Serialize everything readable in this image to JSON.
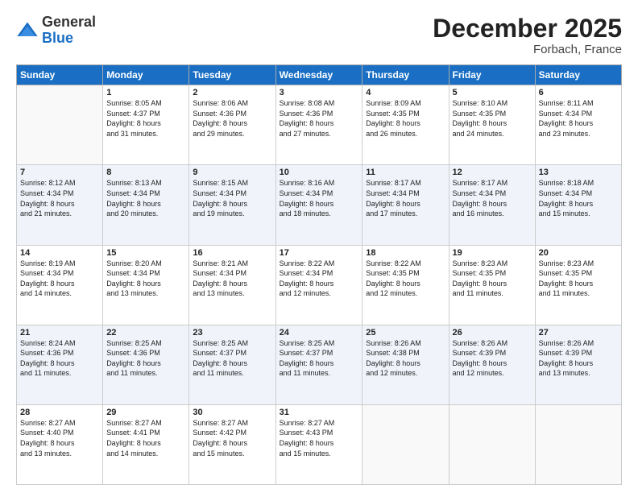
{
  "logo": {
    "general": "General",
    "blue": "Blue"
  },
  "title": "December 2025",
  "subtitle": "Forbach, France",
  "days_header": [
    "Sunday",
    "Monday",
    "Tuesday",
    "Wednesday",
    "Thursday",
    "Friday",
    "Saturday"
  ],
  "weeks": [
    [
      {
        "day": "",
        "info": ""
      },
      {
        "day": "1",
        "info": "Sunrise: 8:05 AM\nSunset: 4:37 PM\nDaylight: 8 hours\nand 31 minutes."
      },
      {
        "day": "2",
        "info": "Sunrise: 8:06 AM\nSunset: 4:36 PM\nDaylight: 8 hours\nand 29 minutes."
      },
      {
        "day": "3",
        "info": "Sunrise: 8:08 AM\nSunset: 4:36 PM\nDaylight: 8 hours\nand 27 minutes."
      },
      {
        "day": "4",
        "info": "Sunrise: 8:09 AM\nSunset: 4:35 PM\nDaylight: 8 hours\nand 26 minutes."
      },
      {
        "day": "5",
        "info": "Sunrise: 8:10 AM\nSunset: 4:35 PM\nDaylight: 8 hours\nand 24 minutes."
      },
      {
        "day": "6",
        "info": "Sunrise: 8:11 AM\nSunset: 4:34 PM\nDaylight: 8 hours\nand 23 minutes."
      }
    ],
    [
      {
        "day": "7",
        "info": "Sunrise: 8:12 AM\nSunset: 4:34 PM\nDaylight: 8 hours\nand 21 minutes."
      },
      {
        "day": "8",
        "info": "Sunrise: 8:13 AM\nSunset: 4:34 PM\nDaylight: 8 hours\nand 20 minutes."
      },
      {
        "day": "9",
        "info": "Sunrise: 8:15 AM\nSunset: 4:34 PM\nDaylight: 8 hours\nand 19 minutes."
      },
      {
        "day": "10",
        "info": "Sunrise: 8:16 AM\nSunset: 4:34 PM\nDaylight: 8 hours\nand 18 minutes."
      },
      {
        "day": "11",
        "info": "Sunrise: 8:17 AM\nSunset: 4:34 PM\nDaylight: 8 hours\nand 17 minutes."
      },
      {
        "day": "12",
        "info": "Sunrise: 8:17 AM\nSunset: 4:34 PM\nDaylight: 8 hours\nand 16 minutes."
      },
      {
        "day": "13",
        "info": "Sunrise: 8:18 AM\nSunset: 4:34 PM\nDaylight: 8 hours\nand 15 minutes."
      }
    ],
    [
      {
        "day": "14",
        "info": "Sunrise: 8:19 AM\nSunset: 4:34 PM\nDaylight: 8 hours\nand 14 minutes."
      },
      {
        "day": "15",
        "info": "Sunrise: 8:20 AM\nSunset: 4:34 PM\nDaylight: 8 hours\nand 13 minutes."
      },
      {
        "day": "16",
        "info": "Sunrise: 8:21 AM\nSunset: 4:34 PM\nDaylight: 8 hours\nand 13 minutes."
      },
      {
        "day": "17",
        "info": "Sunrise: 8:22 AM\nSunset: 4:34 PM\nDaylight: 8 hours\nand 12 minutes."
      },
      {
        "day": "18",
        "info": "Sunrise: 8:22 AM\nSunset: 4:35 PM\nDaylight: 8 hours\nand 12 minutes."
      },
      {
        "day": "19",
        "info": "Sunrise: 8:23 AM\nSunset: 4:35 PM\nDaylight: 8 hours\nand 11 minutes."
      },
      {
        "day": "20",
        "info": "Sunrise: 8:23 AM\nSunset: 4:35 PM\nDaylight: 8 hours\nand 11 minutes."
      }
    ],
    [
      {
        "day": "21",
        "info": "Sunrise: 8:24 AM\nSunset: 4:36 PM\nDaylight: 8 hours\nand 11 minutes."
      },
      {
        "day": "22",
        "info": "Sunrise: 8:25 AM\nSunset: 4:36 PM\nDaylight: 8 hours\nand 11 minutes."
      },
      {
        "day": "23",
        "info": "Sunrise: 8:25 AM\nSunset: 4:37 PM\nDaylight: 8 hours\nand 11 minutes."
      },
      {
        "day": "24",
        "info": "Sunrise: 8:25 AM\nSunset: 4:37 PM\nDaylight: 8 hours\nand 11 minutes."
      },
      {
        "day": "25",
        "info": "Sunrise: 8:26 AM\nSunset: 4:38 PM\nDaylight: 8 hours\nand 12 minutes."
      },
      {
        "day": "26",
        "info": "Sunrise: 8:26 AM\nSunset: 4:39 PM\nDaylight: 8 hours\nand 12 minutes."
      },
      {
        "day": "27",
        "info": "Sunrise: 8:26 AM\nSunset: 4:39 PM\nDaylight: 8 hours\nand 13 minutes."
      }
    ],
    [
      {
        "day": "28",
        "info": "Sunrise: 8:27 AM\nSunset: 4:40 PM\nDaylight: 8 hours\nand 13 minutes."
      },
      {
        "day": "29",
        "info": "Sunrise: 8:27 AM\nSunset: 4:41 PM\nDaylight: 8 hours\nand 14 minutes."
      },
      {
        "day": "30",
        "info": "Sunrise: 8:27 AM\nSunset: 4:42 PM\nDaylight: 8 hours\nand 15 minutes."
      },
      {
        "day": "31",
        "info": "Sunrise: 8:27 AM\nSunset: 4:43 PM\nDaylight: 8 hours\nand 15 minutes."
      },
      {
        "day": "",
        "info": ""
      },
      {
        "day": "",
        "info": ""
      },
      {
        "day": "",
        "info": ""
      }
    ]
  ]
}
